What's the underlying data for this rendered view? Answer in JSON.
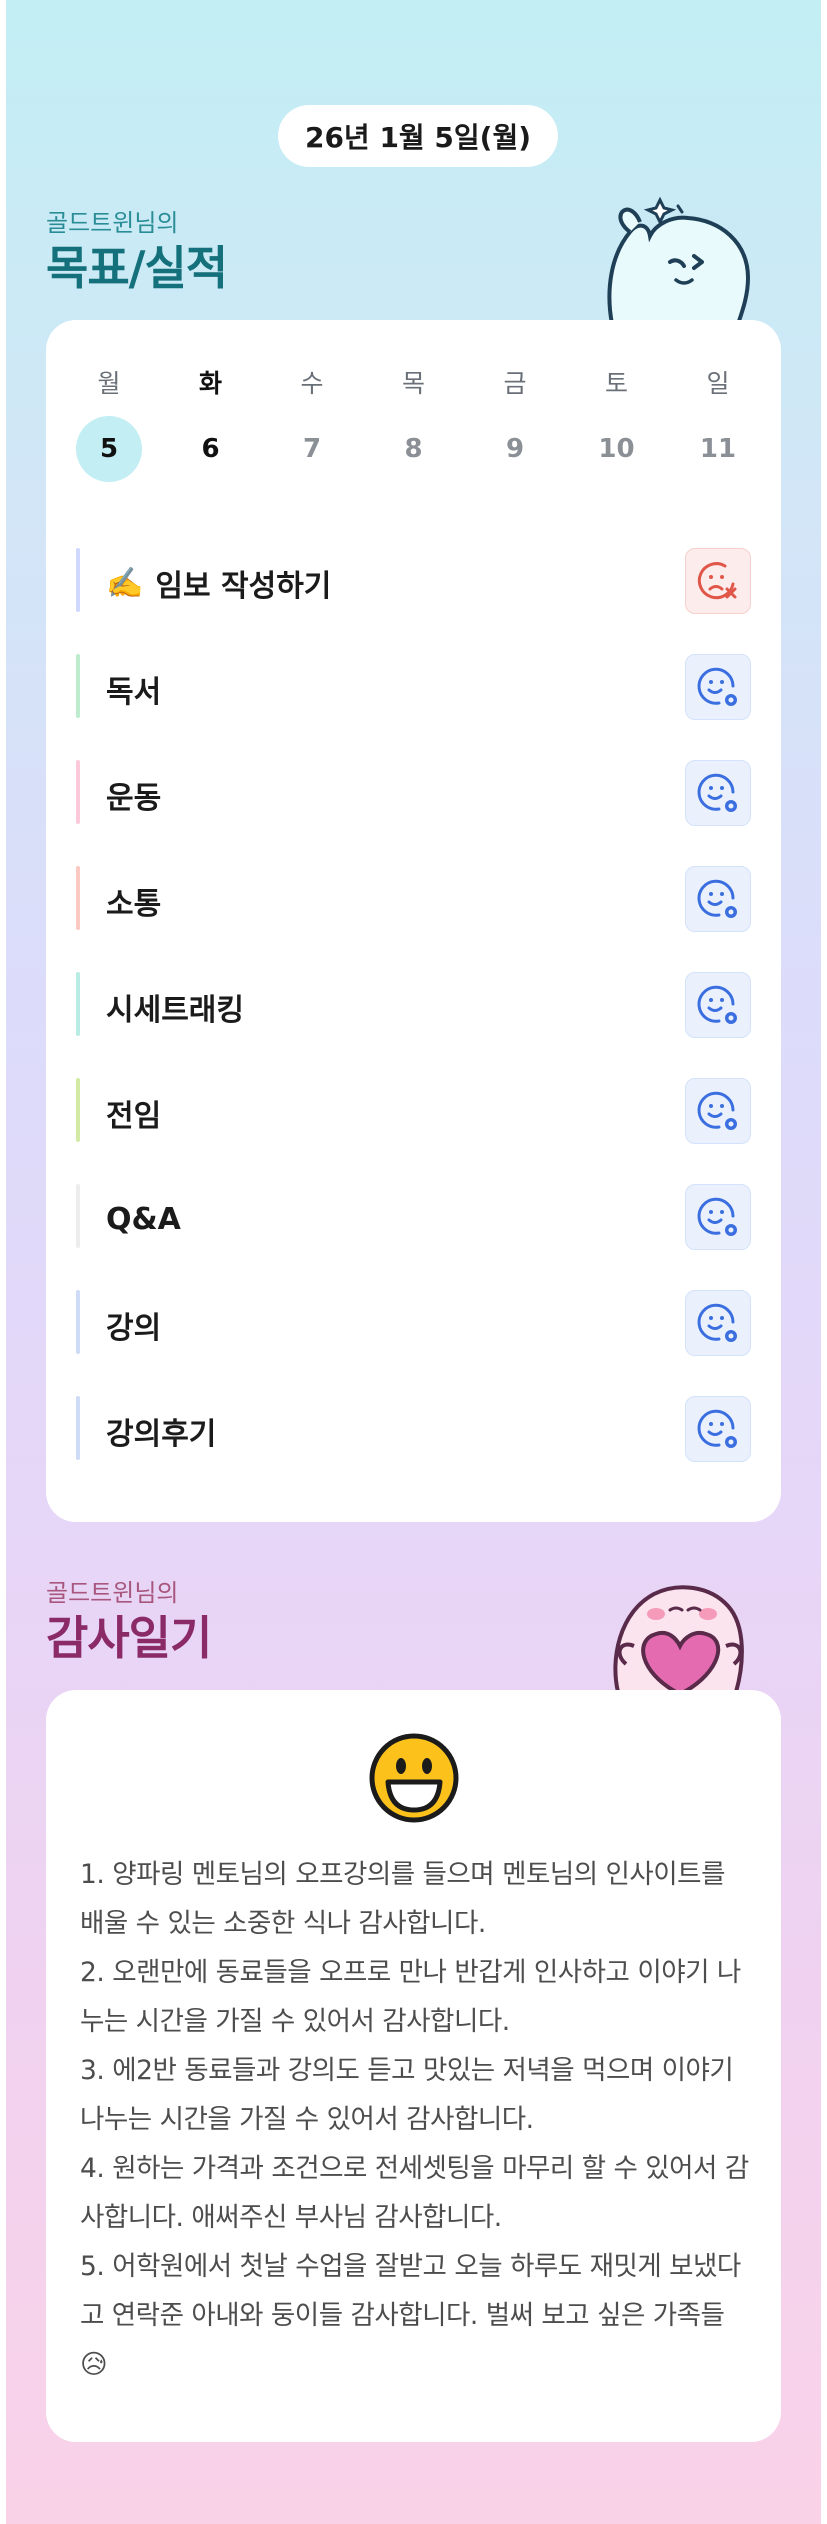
{
  "header": {
    "date": "26년 1월 5일(월)"
  },
  "goals_section": {
    "subtitle": "골드트윈님의",
    "title": "목표/실적"
  },
  "week": {
    "weekdays": [
      "월",
      "화",
      "수",
      "목",
      "금",
      "토",
      "일"
    ],
    "dates": [
      "5",
      "6",
      "7",
      "8",
      "9",
      "10",
      "11"
    ],
    "selected_index": 0
  },
  "goals": [
    {
      "label": "임보 작성하기",
      "icon": "writing-hand-icon",
      "bar_color": "#cfd8ff",
      "status": "failed"
    },
    {
      "label": "독서",
      "bar_color": "#bdeccf",
      "status": "pending"
    },
    {
      "label": "운동",
      "bar_color": "#fbc9da",
      "status": "pending"
    },
    {
      "label": "소통",
      "bar_color": "#fbc8c2",
      "status": "pending"
    },
    {
      "label": "시세트래킹",
      "bar_color": "#b9ece4",
      "status": "pending"
    },
    {
      "label": "전임",
      "bar_color": "#d3eaa6",
      "status": "pending"
    },
    {
      "label": "Q&A",
      "bar_color": "#ededed",
      "status": "pending"
    },
    {
      "label": "강의",
      "bar_color": "#cfdcf8",
      "status": "pending"
    },
    {
      "label": "강의후기",
      "bar_color": "#cfdcf8",
      "status": "pending"
    }
  ],
  "diary_section": {
    "subtitle": "골드트윈님의",
    "title": "감사일기",
    "mood_icon": "grinning-face-icon",
    "entries": [
      "1. 양파링 멘토님의 오프강의를 들으며 멘토님의 인사이트를 배울 수 있는 소중한 식나 감사합니다.",
      "2. 오랜만에 동료들을 오프로 만나 반갑게 인사하고 이야기 나누는 시간을 가질 수 있어서 감사합니다.",
      "3. 에2반 동료들과 강의도 듣고 맛있는 저녁을 먹으며 이야기 나누는 시간을 가질 수 있어서 감사합니다.",
      "4. 원하는 가격과 조건으로 전세셋팅을 마무리 할 수 있어서 감사합니다. 애써주신 부사님 감사합니다.",
      "5. 어학원에서 첫날 수업을 잘받고 오늘 하루도 재밋게 보냈다고 연락준 아내와 둥이들 감사합니다. 벌써 보고 싶은 가족들 😥"
    ]
  },
  "colors": {
    "teal_title": "#14707a",
    "pink_title": "#8a2a66",
    "pending_icon": "#3b6fe0",
    "failed_icon": "#e0574a"
  }
}
